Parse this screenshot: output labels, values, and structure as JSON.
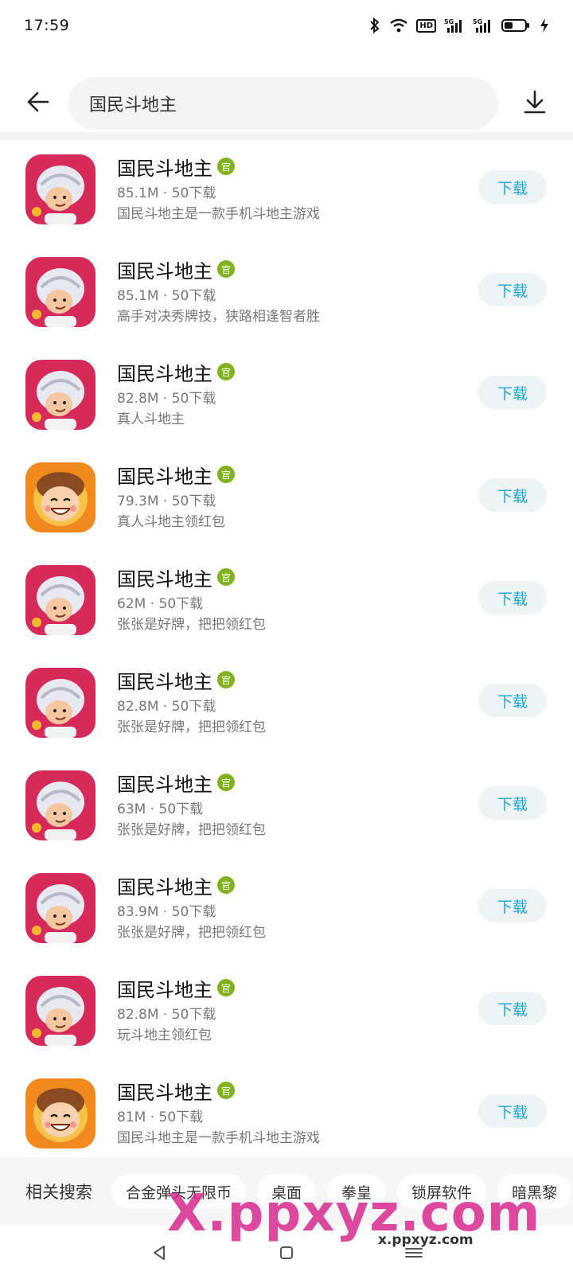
{
  "status_bar": {
    "time": "17:59",
    "hd_label": "HD",
    "signal_1_label": "5G",
    "signal_2_label": "5G"
  },
  "header": {
    "search_value": "国民斗地主",
    "back_icon": "arrow-left-icon",
    "download_icon": "download-icon"
  },
  "colors": {
    "accent": "#1ba7d5",
    "official_badge": "#7fb21c",
    "chip_bg": "#f6f6f6"
  },
  "apps": [
    {
      "name": "国民斗地主",
      "badge": "官",
      "meta": "85.1M · 50下载",
      "desc": "国民斗地主是一款手机斗地主游戏",
      "icon": "turban-man",
      "button": "下载"
    },
    {
      "name": "国民斗地主",
      "badge": "官",
      "meta": "85.1M · 50下载",
      "desc": "高手对决秀牌技，狭路相逢智者胜",
      "icon": "turban-man",
      "button": "下载"
    },
    {
      "name": "国民斗地主",
      "badge": "官",
      "meta": "82.8M · 50下载",
      "desc": "真人斗地主",
      "icon": "turban-man",
      "button": "下载"
    },
    {
      "name": "国民斗地主",
      "badge": "官",
      "meta": "79.3M · 50下载",
      "desc": "真人斗地主领红包",
      "icon": "smiling-boy",
      "button": "下载"
    },
    {
      "name": "国民斗地主",
      "badge": "官",
      "meta": "62M · 50下载",
      "desc": "张张是好牌，把把领红包",
      "icon": "turban-man",
      "button": "下载"
    },
    {
      "name": "国民斗地主",
      "badge": "官",
      "meta": "82.8M · 50下载",
      "desc": "张张是好牌，把把领红包",
      "icon": "turban-man",
      "button": "下载"
    },
    {
      "name": "国民斗地主",
      "badge": "官",
      "meta": "63M · 50下载",
      "desc": "张张是好牌，把把领红包",
      "icon": "turban-man",
      "button": "下载"
    },
    {
      "name": "国民斗地主",
      "badge": "官",
      "meta": "83.9M · 50下载",
      "desc": "张张是好牌，把把领红包",
      "icon": "turban-man",
      "button": "下载"
    },
    {
      "name": "国民斗地主",
      "badge": "官",
      "meta": "82.8M · 50下载",
      "desc": "玩斗地主领红包",
      "icon": "turban-man",
      "button": "下载"
    },
    {
      "name": "国民斗地主",
      "badge": "官",
      "meta": "81M · 50下载",
      "desc": "国民斗地主是一款手机斗地主游戏",
      "icon": "smiling-boy",
      "button": "下载"
    }
  ],
  "related": {
    "label": "相关搜索",
    "chips": [
      "合金弹头无限币",
      "桌面",
      "拳皇",
      "锁屏软件",
      "暗黑黎"
    ]
  },
  "watermark": {
    "main": "X.ppxyz.com",
    "sub": "x.ppxyz.com"
  }
}
